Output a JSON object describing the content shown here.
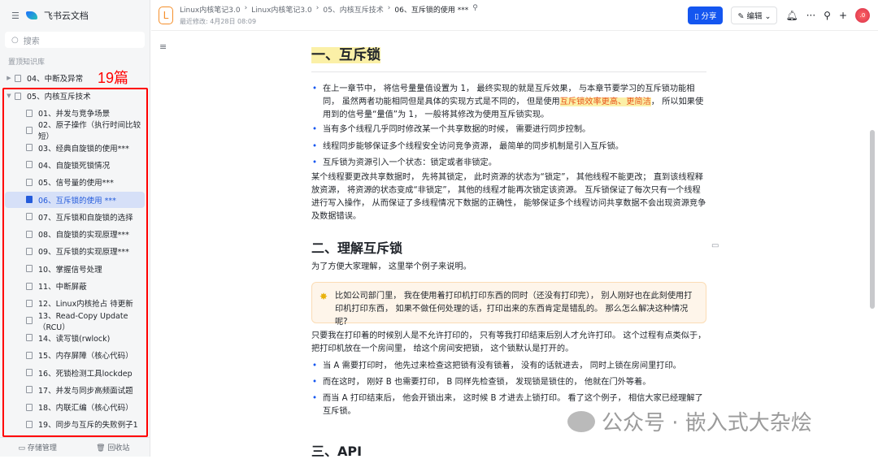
{
  "sidebar": {
    "app_name": "飞书云文档",
    "search_placeholder": "搜索",
    "section": "置顶知识库",
    "annotation": "19篇",
    "parent_prev": "04、中断及异常",
    "parent": "05、内核互斥技术",
    "items": [
      "01、并发与竞争场景",
      "02、原子操作（执行时间比较短）",
      "03、经典自旋锁的使用***",
      "04、自旋锁死锁情况",
      "05、信号量的使用***",
      "06、互斥锁的使用 ***",
      "07、互斥锁和自旋锁的选择",
      "08、自旋锁的实现原理***",
      "09、互斥锁的实现原理***",
      "10、掌握信号处理",
      "11、中断屏蔽",
      "12、Linux内核抢占 待更新",
      "13、Read-Copy Update（RCU）",
      "14、读写锁(rwlock)",
      "15、内存屏障（核心代码）",
      "16、死锁检测工具lockdep",
      "17、并发与同步高频面试题",
      "18、内联汇编（核心代码）",
      "19、同步与互斥的失败例子1"
    ],
    "active_index": 5,
    "storage": "存储管理",
    "trash": "回收站"
  },
  "header": {
    "avatar_letter": "L",
    "breadcrumbs": [
      "Linux内核笔记3.0",
      "Linux内核笔记3.0",
      "05、内核互斥技术",
      "06、互斥锁的使用 ***"
    ],
    "modified": "最近修改: 4月28日 08:09",
    "share": "分享",
    "edit": "编辑",
    "user": ".0"
  },
  "doc": {
    "h1": "一、互斥锁",
    "b1a": "在上一章节中， 将信号量量值设置为 1， 最终实现的就是互斥效果， 与本章节要学习的互斥锁功能相同， 虽然两者功能相同但是具体的实现方式是不同的， 但是使用",
    "b1mark": "互斥锁效率更高、更简洁",
    "b1b": "， 所以如果使用到的信号量“量值”为 1， 一般将其修改为使用互斥锁实现。",
    "b2": "当有多个线程几乎同时修改某一个共享数据的时候， 需要进行同步控制。",
    "b3": "线程同步能够保证多个线程安全访问竞争资源， 最简单的同步机制是引入互斥锁。",
    "b4": "互斥锁为资源引入一个状态：锁定或者非锁定。",
    "p1": "某个线程要更改共享数据时， 先将其锁定， 此时资源的状态为“锁定”， 其他线程不能更改； 直到该线程释放资源， 将资源的状态变成“非锁定”， 其他的线程才能再次锁定该资源。 互斥锁保证了每次只有一个线程进行写入操作， 从而保证了多线程情况下数据的正确性， 能够保证多个线程访问共享数据不会出现资源竞争及数据错误。",
    "h2": "二、理解互斥锁",
    "p2": "为了方便大家理解， 这里举个例子来说明。",
    "callout": "比如公司部门里， 我在使用着打印机打印东西的同时（还没有打印完）， 别人刚好也在此刻使用打印机打印东西， 如果不做任何处理的话，打印出来的东西肯定是错乱的。 那么怎么解决这种情况呢?",
    "p3": "只要我在打印着的时候别人是不允许打印的， 只有等我打印结束后别人才允许打印。 这个过程有点类似于， 把打印机放在一个房间里， 给这个房间安把锁， 这个锁默认是打开的。",
    "b5": "当 A 需要打印时， 他先过来检查这把锁有没有锁着， 没有的话就进去， 同时上锁在房间里打印。",
    "b6": "而在这时， 刚好 B 也需要打印， B 同样先检查锁， 发现锁是锁住的， 他就在门外等着。",
    "b7": "而当 A 打印结束后， 他会开锁出来， 这时候 B 才进去上锁打印。 看了这个例子， 相信大家已经理解了互斥锁。",
    "h3": "三、API"
  },
  "watermark": "公众号 · 嵌入式大杂烩"
}
